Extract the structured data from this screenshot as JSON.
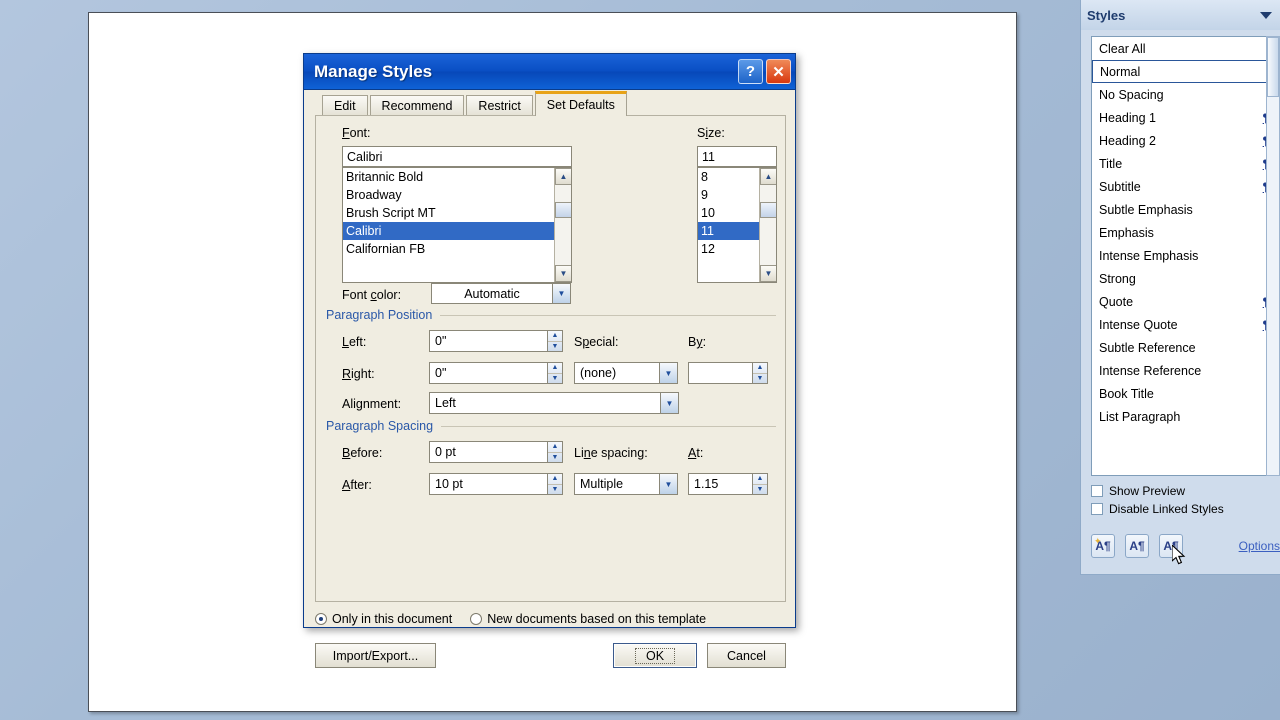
{
  "dialog": {
    "title": "Manage Styles",
    "help_button": "?",
    "close_button": "✕",
    "tabs": [
      {
        "label": "Edit",
        "active": false
      },
      {
        "label": "Recommend",
        "active": false
      },
      {
        "label": "Restrict",
        "active": false
      },
      {
        "label": "Set Defaults",
        "active": true
      }
    ],
    "font_label": "Font:",
    "font_value": "Calibri",
    "font_list": [
      "Britannic Bold",
      "Broadway",
      "Brush Script MT",
      "Calibri",
      "Californian FB"
    ],
    "font_selected": "Calibri",
    "size_label": "Size:",
    "size_value": "11",
    "size_list": [
      "8",
      "9",
      "10",
      "11",
      "12"
    ],
    "size_selected": "11",
    "font_color_label": "Font color:",
    "font_color_value": "Automatic",
    "paragraph_position_head": "Paragraph Position",
    "left_label": "Left:",
    "left_value": "0\"",
    "right_label": "Right:",
    "right_value": "0\"",
    "special_label": "Special:",
    "special_value": "(none)",
    "by_label": "By:",
    "by_value": "",
    "alignment_label": "Alignment:",
    "alignment_value": "Left",
    "paragraph_spacing_head": "Paragraph Spacing",
    "before_label": "Before:",
    "before_value": "0 pt",
    "after_label": "After:",
    "after_value": "10 pt",
    "line_spacing_label": "Line spacing:",
    "line_spacing_value": "Multiple",
    "at_label": "At:",
    "at_value": "1.15",
    "radio_only_document": "Only in this document",
    "radio_new_documents": "New documents based on this template",
    "radio_selected": "only_document",
    "import_export_button": "Import/Export...",
    "ok_button": "OK",
    "cancel_button": "Cancel"
  },
  "styles_pane": {
    "title": "Styles",
    "collapse_icon": "chevron-down-icon",
    "items": [
      {
        "label": "Clear All",
        "icon": "",
        "selected": false
      },
      {
        "label": "Normal",
        "icon": "¶",
        "icon_type": "paragraph",
        "selected": true
      },
      {
        "label": "No Spacing",
        "icon": "¶",
        "icon_type": "paragraph",
        "selected": false
      },
      {
        "label": "Heading 1",
        "icon": "¶a",
        "icon_type": "linked",
        "selected": false
      },
      {
        "label": "Heading 2",
        "icon": "¶a",
        "icon_type": "linked",
        "selected": false
      },
      {
        "label": "Title",
        "icon": "¶a",
        "icon_type": "linked",
        "selected": false
      },
      {
        "label": "Subtitle",
        "icon": "¶a",
        "icon_type": "linked",
        "selected": false
      },
      {
        "label": "Subtle Emphasis",
        "icon": "a",
        "icon_type": "character",
        "selected": false
      },
      {
        "label": "Emphasis",
        "icon": "a",
        "icon_type": "character",
        "selected": false
      },
      {
        "label": "Intense Emphasis",
        "icon": "a",
        "icon_type": "character",
        "selected": false
      },
      {
        "label": "Strong",
        "icon": "a",
        "icon_type": "character",
        "selected": false
      },
      {
        "label": "Quote",
        "icon": "¶a",
        "icon_type": "linked",
        "selected": false
      },
      {
        "label": "Intense Quote",
        "icon": "¶a",
        "icon_type": "linked",
        "selected": false
      },
      {
        "label": "Subtle Reference",
        "icon": "a",
        "icon_type": "character",
        "selected": false
      },
      {
        "label": "Intense Reference",
        "icon": "a",
        "icon_type": "character",
        "selected": false
      },
      {
        "label": "Book Title",
        "icon": "a",
        "icon_type": "character",
        "selected": false
      },
      {
        "label": "List Paragraph",
        "icon": "¶",
        "icon_type": "paragraph",
        "selected": false
      }
    ],
    "show_preview_label": "Show Preview",
    "show_preview_checked": false,
    "disable_linked_label": "Disable Linked Styles",
    "disable_linked_checked": false,
    "buttons": [
      {
        "name": "new-style-button",
        "glyph": "A"
      },
      {
        "name": "style-inspector-button",
        "glyph": "A"
      },
      {
        "name": "manage-styles-button",
        "glyph": "A"
      }
    ],
    "options_link": "Options"
  },
  "colors": {
    "titlebar_blue": "#0a4fc4",
    "selection_blue": "#316ac5",
    "active_tab_accent": "#e8a317",
    "section_head_blue": "#2a58a8",
    "pane_bg": "#cfdcec",
    "desktop_bg": "#a6bcd6",
    "link_blue": "#3b5fc0"
  }
}
